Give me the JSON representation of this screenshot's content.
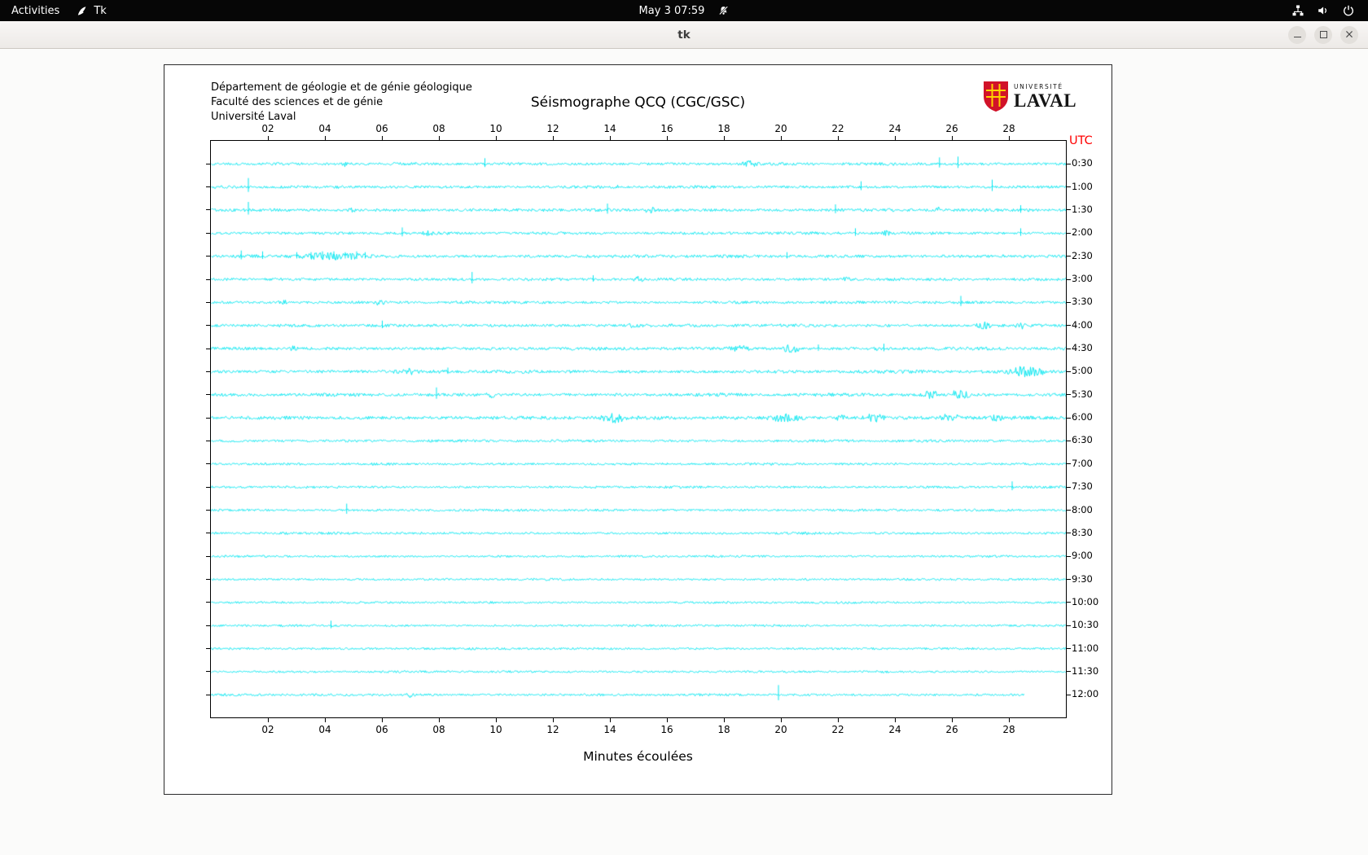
{
  "topbar": {
    "activities": "Activities",
    "app_name": "Tk",
    "clock": "May 3  07:59"
  },
  "window": {
    "title": "tk"
  },
  "plot": {
    "header_lines": [
      "Département de géologie et de génie géologique",
      "Faculté des sciences et de génie",
      "Université Laval"
    ],
    "title": "Séismographe QCQ (CGC/GSC)",
    "logo_line1": "UNIVERSITÉ",
    "logo_line2": "LAVAL",
    "utc_label": "UTC",
    "xlabel": "Minutes écoulées",
    "x_ticks": [
      "02",
      "04",
      "06",
      "08",
      "10",
      "12",
      "14",
      "16",
      "18",
      "20",
      "22",
      "24",
      "26",
      "28"
    ],
    "colors": {
      "trace": "#00e6f0",
      "utc": "#ff0000",
      "laval_red": "#d11229",
      "laval_yellow": "#ffd200"
    },
    "rows": [
      {
        "label": "0:30",
        "amp": 1.2,
        "spikes": [
          [
            9.6,
            7
          ],
          [
            25.55,
            8
          ],
          [
            26.2,
            9
          ]
        ],
        "bursts": [
          [
            4.5,
            4.9,
            2.5
          ],
          [
            18.6,
            19.2,
            2.5
          ]
        ]
      },
      {
        "label": "1:00",
        "amp": 1.2,
        "spikes": [
          [
            1.3,
            11
          ],
          [
            22.8,
            7
          ],
          [
            27.4,
            9
          ]
        ],
        "bursts": [
          [
            14.0,
            14.3,
            2
          ]
        ]
      },
      {
        "label": "1:30",
        "amp": 1.3,
        "spikes": [
          [
            1.3,
            10
          ],
          [
            13.9,
            8
          ],
          [
            21.9,
            7
          ],
          [
            28.4,
            6
          ]
        ],
        "bursts": [
          [
            4.8,
            5.1,
            2
          ],
          [
            15.2,
            15.6,
            2.5
          ],
          [
            25.4,
            25.7,
            3
          ]
        ]
      },
      {
        "label": "2:00",
        "amp": 1.2,
        "spikes": [
          [
            6.7,
            7
          ],
          [
            22.6,
            6
          ],
          [
            28.4,
            6
          ]
        ],
        "bursts": [
          [
            7.4,
            7.8,
            2.5
          ],
          [
            23.5,
            23.9,
            2
          ]
        ]
      },
      {
        "label": "2:30",
        "amp": 1.3,
        "spikes": [
          [
            1.05,
            7
          ],
          [
            1.8,
            6
          ],
          [
            3.0,
            5
          ],
          [
            3.5,
            5
          ],
          [
            3.9,
            6
          ],
          [
            4.3,
            6
          ],
          [
            4.7,
            5
          ],
          [
            5.1,
            6
          ],
          [
            5.4,
            5
          ],
          [
            20.2,
            5
          ]
        ],
        "bursts": [
          [
            2.7,
            5.7,
            3
          ]
        ]
      },
      {
        "label": "3:00",
        "amp": 1.2,
        "spikes": [
          [
            9.15,
            9
          ],
          [
            13.4,
            5
          ]
        ],
        "bursts": [
          [
            14.8,
            15.2,
            2.5
          ],
          [
            22.1,
            22.5,
            2
          ]
        ]
      },
      {
        "label": "3:30",
        "amp": 1.2,
        "spikes": [
          [
            26.3,
            8
          ]
        ],
        "bursts": [
          [
            2.3,
            2.7,
            2
          ],
          [
            5.7,
            6.1,
            2
          ]
        ]
      },
      {
        "label": "4:00",
        "amp": 1.3,
        "spikes": [
          [
            6.0,
            6
          ]
        ],
        "bursts": [
          [
            14.6,
            15.0,
            2
          ],
          [
            26.8,
            27.4,
            3.5
          ],
          [
            28.2,
            28.6,
            3.5
          ]
        ]
      },
      {
        "label": "4:30",
        "amp": 1.3,
        "spikes": [
          [
            21.3,
            5
          ],
          [
            23.6,
            6
          ]
        ],
        "bursts": [
          [
            2.7,
            3.1,
            2
          ],
          [
            18.0,
            19.1,
            3
          ],
          [
            20.0,
            20.7,
            4.5
          ],
          [
            23.0,
            23.4,
            2
          ]
        ]
      },
      {
        "label": "5:00",
        "amp": 1.4,
        "spikes": [
          [
            8.3,
            5
          ]
        ],
        "bursts": [
          [
            6.7,
            7.2,
            3
          ],
          [
            27.8,
            29.4,
            5
          ]
        ]
      },
      {
        "label": "5:30",
        "amp": 1.4,
        "spikes": [
          [
            7.9,
            9
          ]
        ],
        "bursts": [
          [
            9.6,
            10.0,
            2.5
          ],
          [
            24.8,
            25.6,
            4
          ],
          [
            25.8,
            26.7,
            4.5
          ]
        ]
      },
      {
        "label": "6:00",
        "amp": 1.5,
        "spikes": [],
        "bursts": [
          [
            13.6,
            14.6,
            4.5
          ],
          [
            19.4,
            20.9,
            3.5
          ],
          [
            21.9,
            22.3,
            3
          ],
          [
            22.8,
            23.7,
            3.5
          ],
          [
            25.5,
            26.4,
            4.5
          ],
          [
            27.3,
            27.8,
            3
          ]
        ]
      },
      {
        "label": "6:30",
        "amp": 1.1,
        "spikes": [],
        "bursts": []
      },
      {
        "label": "7:00",
        "amp": 1.0,
        "spikes": [],
        "bursts": []
      },
      {
        "label": "7:30",
        "amp": 1.0,
        "spikes": [
          [
            28.1,
            7
          ]
        ],
        "bursts": []
      },
      {
        "label": "8:00",
        "amp": 1.0,
        "spikes": [
          [
            4.75,
            8
          ]
        ],
        "bursts": []
      },
      {
        "label": "8:30",
        "amp": 1.0,
        "spikes": [],
        "bursts": []
      },
      {
        "label": "9:00",
        "amp": 0.9,
        "spikes": [],
        "bursts": []
      },
      {
        "label": "9:30",
        "amp": 0.9,
        "spikes": [],
        "bursts": []
      },
      {
        "label": "10:00",
        "amp": 0.9,
        "spikes": [],
        "bursts": []
      },
      {
        "label": "10:30",
        "amp": 0.9,
        "spikes": [
          [
            4.2,
            6
          ]
        ],
        "bursts": []
      },
      {
        "label": "11:00",
        "amp": 0.9,
        "spikes": [],
        "bursts": []
      },
      {
        "label": "11:30",
        "amp": 0.9,
        "spikes": [],
        "bursts": []
      },
      {
        "label": "12:00",
        "amp": 1.0,
        "spikes": [
          [
            19.9,
            12
          ]
        ],
        "bursts": [
          [
            6.8,
            7.2,
            3
          ]
        ],
        "end": 28.5
      }
    ]
  }
}
